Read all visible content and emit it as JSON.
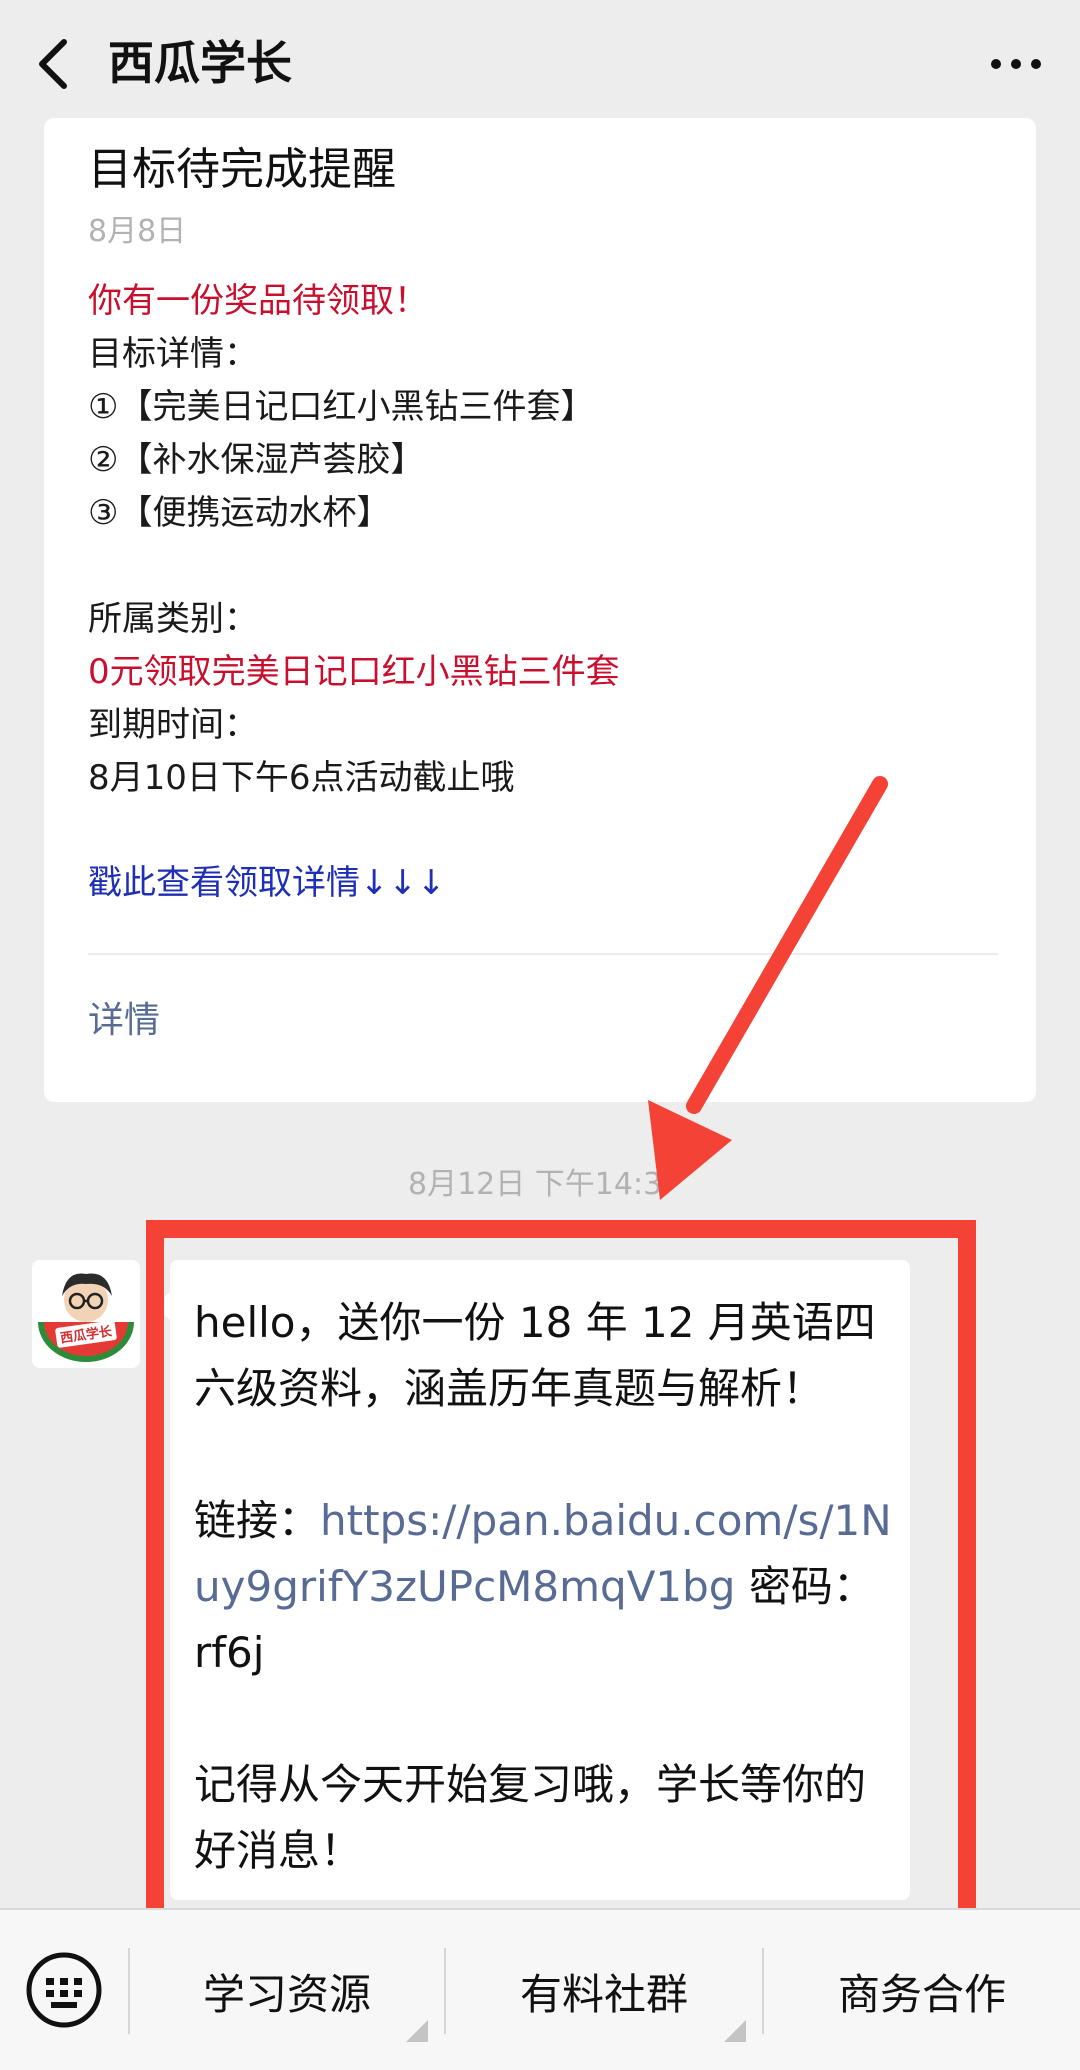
{
  "header": {
    "title": "西瓜学长"
  },
  "article_card": {
    "title": "目标待完成提醒",
    "date": "8月8日",
    "prize_line": "你有一份奖品待领取！",
    "goal_details_label": "目标详情：",
    "goal_items": [
      "①【完美日记口红小黑钻三件套】",
      "②【补水保湿芦荟胶】",
      "③【便携运动水杯】"
    ],
    "category_label": "所属类别：",
    "category_value": "0元领取完美日记口红小黑钻三件套",
    "due_label": "到期时间：",
    "due_value": "8月10日下午6点活动截止哦",
    "cta_link": "戳此查看领取详情↓↓↓",
    "detail_link": "详情"
  },
  "timestamp": "8月12日 下午14:3",
  "message": {
    "intro": "hello，送你一份 18 年 12 月英语四六级资料，涵盖历年真题与解析！",
    "link_label": "链接：",
    "link_url": "https://pan.baidu.com/s/1Nuy9grifY3zUPcM8mqV1bg",
    "password_text": " 密码：rf6j",
    "closing": "记得从今天开始复习哦，学长等你的好消息！"
  },
  "avatar": {
    "label": "西瓜学长"
  },
  "bottom_menu": {
    "items": [
      "学习资源",
      "有料社群",
      "商务合作"
    ]
  },
  "colors": {
    "background": "#ededed",
    "highlight": "#f44336",
    "red_text": "#c8102e",
    "link_blue": "#1f2fb5",
    "wechat_link": "#576b95"
  }
}
